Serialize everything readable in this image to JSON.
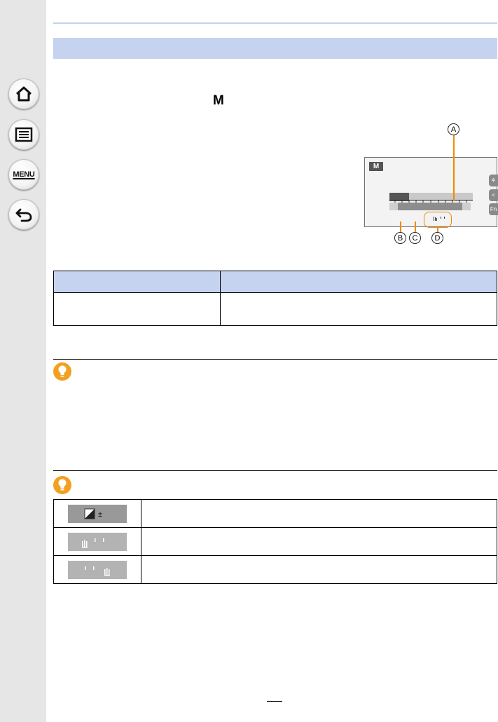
{
  "sidebar": {
    "buttons": [
      {
        "name": "home",
        "icon": "home-icon"
      },
      {
        "name": "contents",
        "icon": "list-icon"
      },
      {
        "name": "menu",
        "icon": "menu-icon",
        "label": "MENU"
      },
      {
        "name": "back",
        "icon": "back-arrow-icon"
      }
    ]
  },
  "main": {
    "mode_letter": "M"
  },
  "illustration": {
    "mode_badge": "M",
    "callouts": {
      "a": "A",
      "b": "B",
      "c": "C",
      "d": "D"
    },
    "side_buttons": [
      "⚘",
      "<",
      "Fn"
    ],
    "accent_color": "#f08a00"
  },
  "colors": {
    "section_bar": "#c6d3f0",
    "sidebar": "#e6e6e6",
    "hint_icon": "#f2a01f"
  }
}
